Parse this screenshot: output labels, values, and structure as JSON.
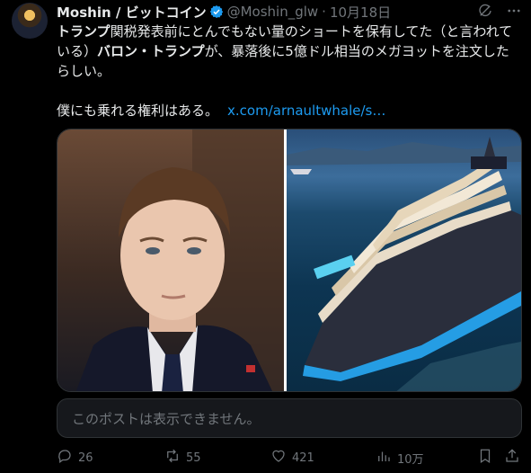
{
  "tweet": {
    "author_name": "Moshin / ビットコイン",
    "handle": "@Moshin_glw",
    "separator": "·",
    "date": "10月18日",
    "line1_bold": "トランプ",
    "line1_rest": "関税発表前にとんでもない量のショートを保有してた（と言われて",
    "line2_start": "いる）",
    "line2_bold": "バロン・トランプ",
    "line2_rest": "が、暴落後に5億ドル相当のメガヨットを注文した",
    "line3": "らしい。",
    "line4": "僕にも乗れる権利はある。",
    "link": "x.com/arnaultwhale/s…",
    "quote_unavailable": "このポストは表示できません。"
  },
  "stats": {
    "replies": "26",
    "reposts": "55",
    "likes": "421",
    "views": "10万"
  },
  "colors": {
    "background": "#000000",
    "text": "#e7e9ea",
    "muted": "#71767b",
    "link": "#1d9bf0",
    "verified": "#1d9bf0"
  },
  "icons": {
    "verified": "verified-badge-icon",
    "grok": "grok-icon",
    "more": "more-icon",
    "reply": "reply-icon",
    "repost": "repost-icon",
    "like": "like-icon",
    "views": "views-icon",
    "bookmark": "bookmark-icon",
    "share": "share-icon"
  }
}
